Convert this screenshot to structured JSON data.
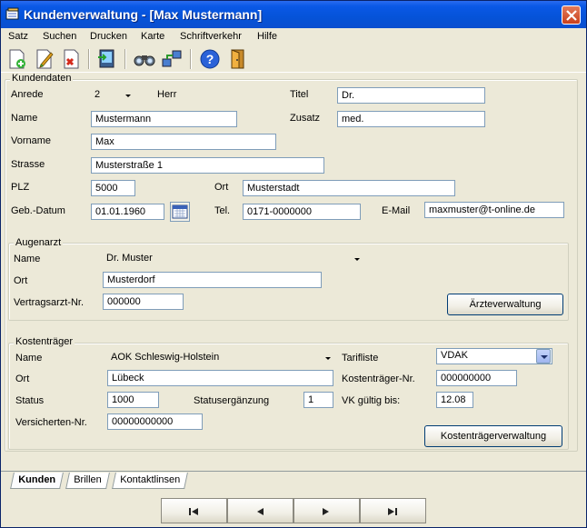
{
  "window": {
    "title": "Kundenverwaltung - [Max Mustermann]"
  },
  "menu": [
    "Satz",
    "Suchen",
    "Drucken",
    "Karte",
    "Schriftverkehr",
    "Hilfe"
  ],
  "toolbar": {
    "icons": [
      "new-record-icon",
      "edit-record-icon",
      "delete-record-icon",
      "import-icon",
      "search-binoculars-icon",
      "connect-icon",
      "help-icon",
      "exit-door-icon"
    ]
  },
  "kundendaten": {
    "title": "Kundendaten",
    "anrede_label": "Anrede",
    "anrede_value": "2",
    "anrede_text": "Herr",
    "titel_label": "Titel",
    "titel_value": "Dr.",
    "name_label": "Name",
    "name_value": "Mustermann",
    "zusatz_label": "Zusatz",
    "zusatz_value": "med.",
    "vorname_label": "Vorname",
    "vorname_value": "Max",
    "strasse_label": "Strasse",
    "strasse_value": "Musterstraße 1",
    "plz_label": "PLZ",
    "plz_value": "5000",
    "ort_label": "Ort",
    "ort_value": "Musterstadt",
    "geb_label": "Geb.-Datum",
    "geb_value": "01.01.1960",
    "tel_label": "Tel.",
    "tel_value": "0171-0000000",
    "email_label": "E-Mail",
    "email_value": "maxmuster@t-online.de"
  },
  "augenarzt": {
    "title": "Augenarzt",
    "name_label": "Name",
    "name_value": "Dr. Muster",
    "ort_label": "Ort",
    "ort_value": "Musterdorf",
    "vertragsarzt_label": "Vertragsarzt-Nr.",
    "vertragsarzt_value": "000000",
    "button": "Ärzteverwaltung"
  },
  "kostentraeger": {
    "title": "Kostenträger",
    "name_label": "Name",
    "name_value": "AOK Schleswig-Holstein",
    "tarifliste_label": "Tarifliste",
    "tarifliste_value": "VDAK",
    "ort_label": "Ort",
    "ort_value": "Lübeck",
    "nr_label": "Kostenträger-Nr.",
    "nr_value": "000000000",
    "status_label": "Status",
    "status_value": "1000",
    "statusergaenzung_label": "Statusergänzung",
    "statusergaenzung_value": "1",
    "vk_label": "VK gültig bis:",
    "vk_value": "12.08",
    "versicherten_label": "Versicherten-Nr.",
    "versicherten_value": "00000000000",
    "button": "Kostenträgerverwaltung"
  },
  "tabs": [
    "Kunden",
    "Brillen",
    "Kontaktlinsen"
  ],
  "active_tab": "Kunden"
}
